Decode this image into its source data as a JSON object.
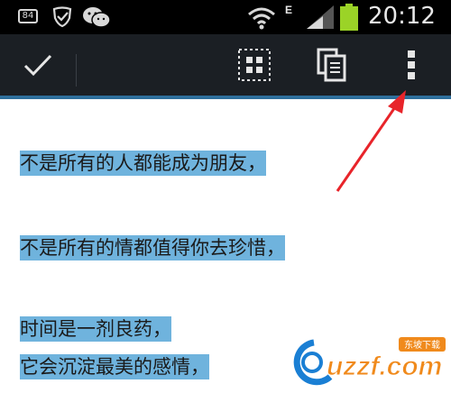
{
  "status_bar": {
    "battery_level": "84",
    "network_type": "E",
    "time": "20:12",
    "icons": [
      "battery-icon",
      "shield-check-icon",
      "wechat-icon",
      "wifi-icon",
      "signal-icon",
      "battery-full-icon"
    ]
  },
  "action_bar": {
    "done_icon": "check-icon",
    "select_all_icon": "select-all-icon",
    "copy_icon": "copy-icon",
    "overflow_icon": "overflow-menu-icon",
    "accent_color": "#2e6f9c"
  },
  "content": {
    "lines": [
      "不是所有的人都能成为朋友，",
      "不是所有的情都值得你去珍惜，",
      "时间是一剂良药，",
      "它会沉淀最美的感情，"
    ],
    "highlight_color": "#6fb3dd"
  },
  "watermark": {
    "text": "uzzf.com",
    "tag": "东坡下载"
  }
}
